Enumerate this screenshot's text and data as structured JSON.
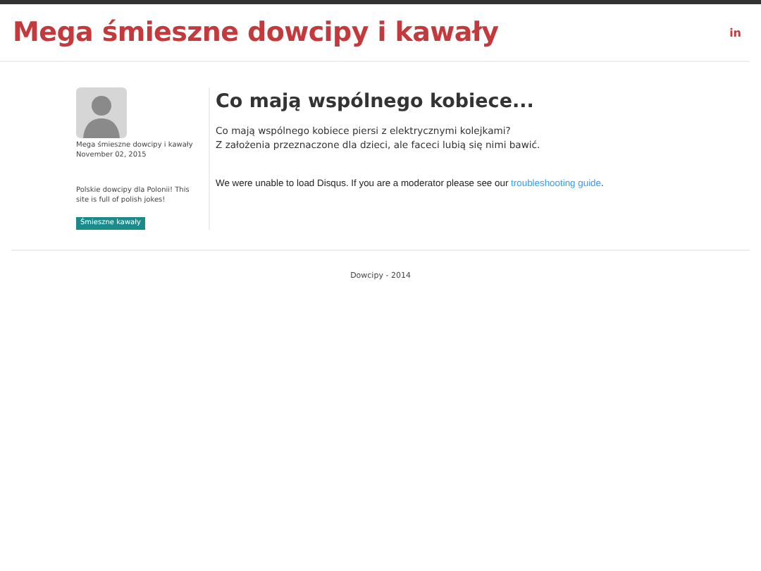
{
  "header": {
    "title": "Mega śmieszne dowcipy i kawały",
    "social_link": "in"
  },
  "sidebar": {
    "author": "Mega śmieszne dowcipy i kawały",
    "date": "November 02, 2015",
    "description": "Polskie dowcipy dla Polonii! This site is full of polish jokes!",
    "tag": "Śmieszne kawały"
  },
  "post": {
    "title": "Co mają wspólnego kobiece...",
    "lines": [
      "Co mają wspólnego kobiece piersi z elektrycznymi kolejkami?",
      "Z założenia przeznaczone dla dzieci, ale faceci lubią się nimi bawić."
    ]
  },
  "comments": {
    "message": "We were unable to load Disqus. If you are a moderator please see our",
    "link": "troubleshooting guide",
    "end": "."
  },
  "footer": "Dowcipy - 2014"
}
